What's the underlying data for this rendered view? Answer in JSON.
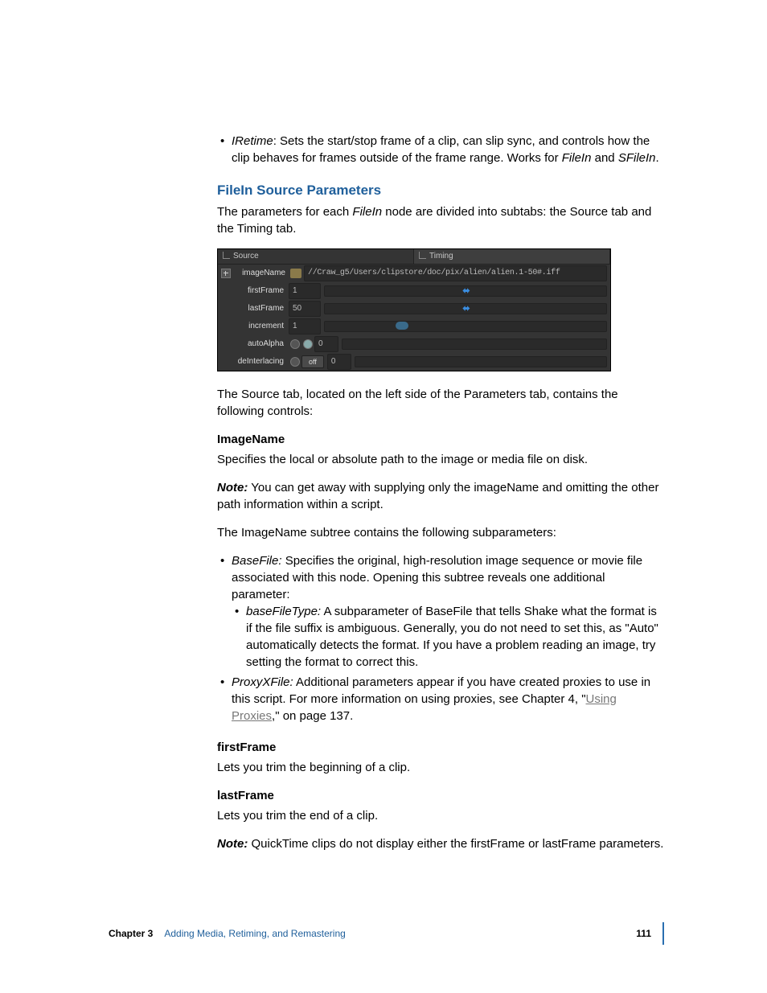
{
  "intro_bullet": {
    "term": "IRetime",
    "desc_1": ":  Sets the start/stop frame of a clip, can slip sync, and controls how the clip behaves for frames outside of the frame range. Works for ",
    "fi": "FileIn",
    "and": " and ",
    "sfi": "SFileIn",
    "period": "."
  },
  "section_heading": "FileIn Source Parameters",
  "section_intro_1": "The parameters for each ",
  "section_intro_term": "FileIn",
  "section_intro_2": " node are divided into subtabs: the Source tab and the Timing tab.",
  "ui": {
    "tab_source": "Source",
    "tab_timing": "Timing",
    "label_imageName": "imageName",
    "value_imageName": "//Craw_g5/Users/clipstore/doc/pix/alien/alien.1-50#.iff",
    "label_firstFrame": "firstFrame",
    "value_firstFrame": "1",
    "label_lastFrame": "lastFrame",
    "value_lastFrame": "50",
    "label_increment": "increment",
    "value_increment": "1",
    "label_autoAlpha": "autoAlpha",
    "value_autoAlpha": "0",
    "label_deInterlacing": "deInterlacing",
    "pill_off": "off",
    "value_deInterlacing": "0"
  },
  "after_ui": "The Source tab, located on the left side of the Parameters tab, contains the following controls:",
  "imageName": {
    "heading": "ImageName",
    "desc": "Specifies the local or absolute path to the image or media file on disk."
  },
  "note1": {
    "label": "Note:",
    "text": "  You can get away with supplying only the imageName and omitting the other path information within a script."
  },
  "subtree_intro": "The ImageName subtree contains the following subparameters:",
  "basefile": {
    "term": "BaseFile:",
    "desc": "  Specifies the original, high-resolution image sequence or movie file associated with this node. Opening this subtree reveals one additional parameter:"
  },
  "basefiletype": {
    "term": "baseFileType:",
    "desc": "  A subparameter of BaseFile that tells Shake what the format is if the file suffix is ambiguous. Generally, you do not need to set this, as \"Auto\" automatically detects the format. If you have a problem reading an image, try setting the format to correct this."
  },
  "proxy": {
    "term": "ProxyXFile:",
    "desc_1": "  Additional parameters appear if you have created proxies to use in this script. For more information on using proxies, see Chapter 4, \"",
    "link": "Using Proxies",
    "desc_2": ",\" on page 137."
  },
  "firstFrame": {
    "heading": "firstFrame",
    "desc": "Lets you trim the beginning of a clip."
  },
  "lastFrame": {
    "heading": "lastFrame",
    "desc": "Lets you trim the end of a clip."
  },
  "note2": {
    "label": "Note:",
    "text": "  QuickTime clips do not display either the firstFrame or lastFrame parameters."
  },
  "footer": {
    "chapter": "Chapter 3",
    "title": "Adding Media, Retiming, and Remastering",
    "page": "111"
  }
}
